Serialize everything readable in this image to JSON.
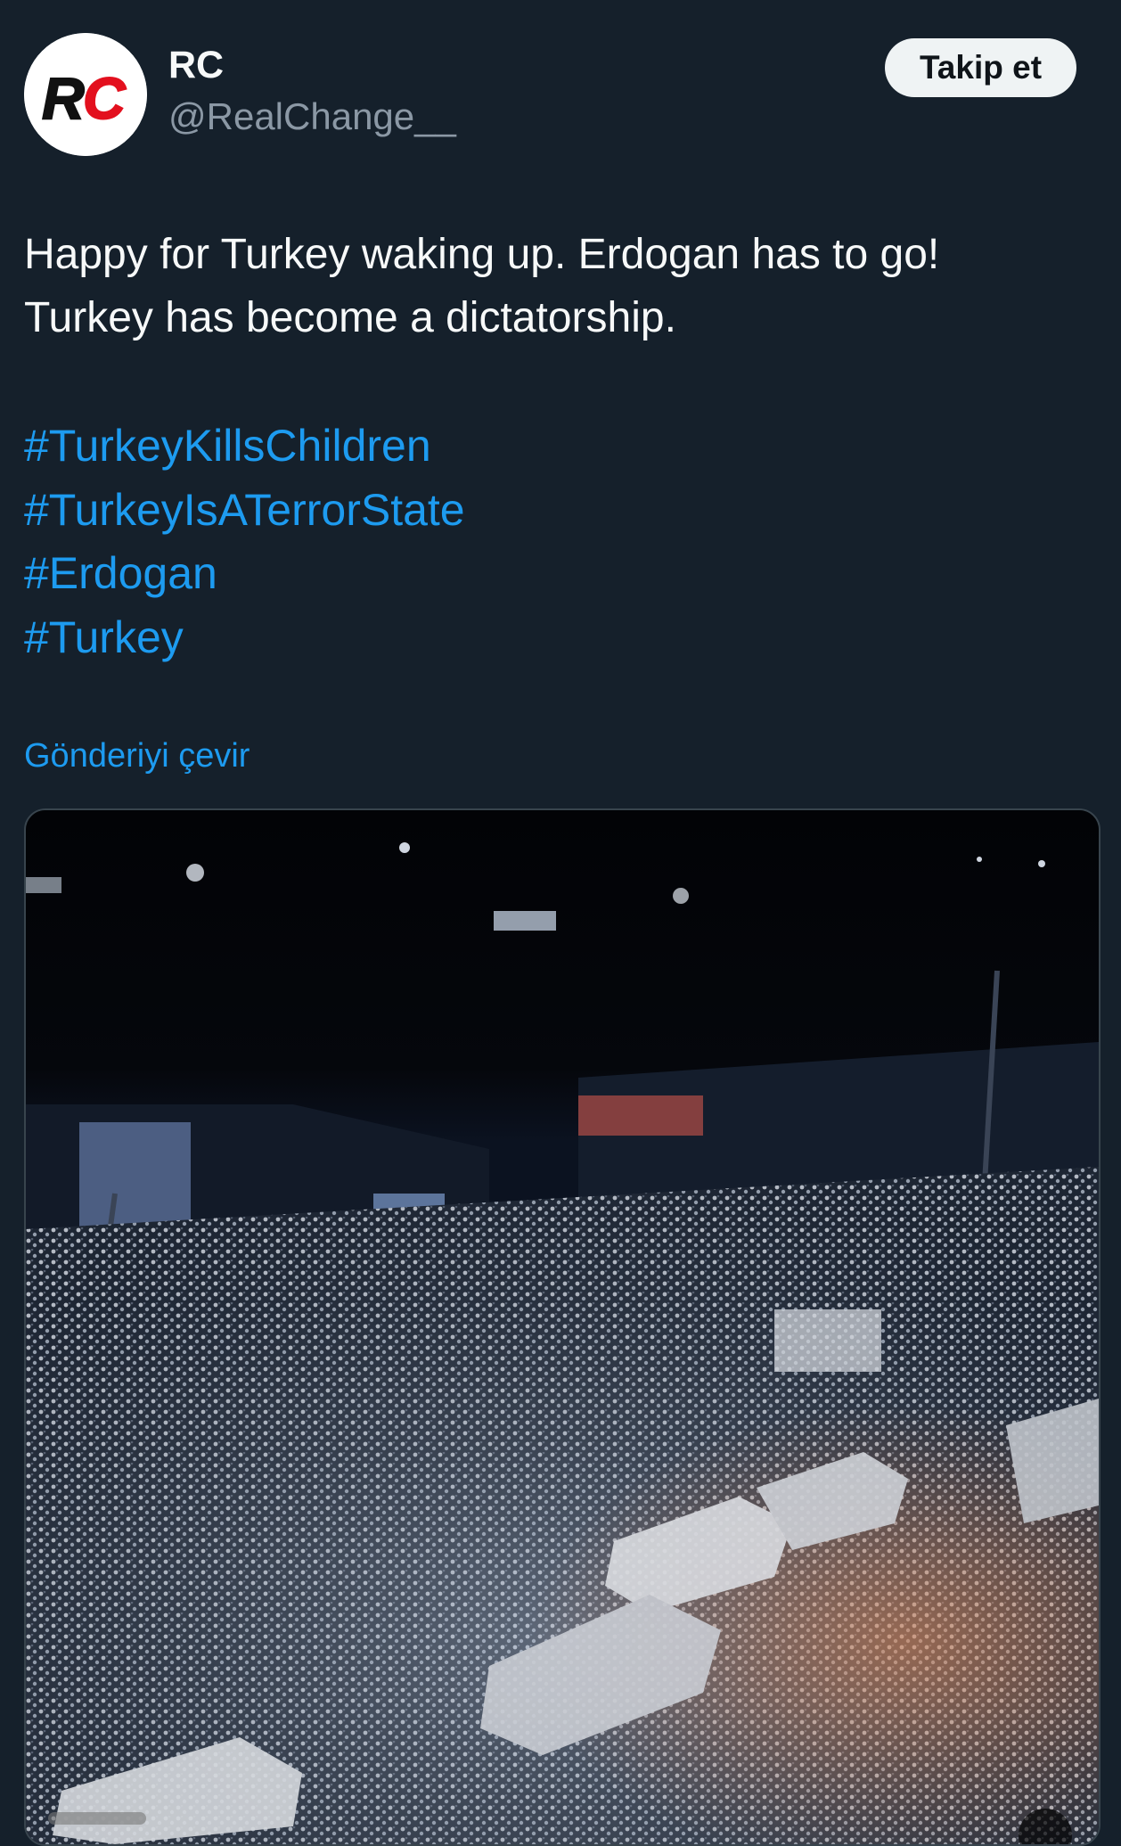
{
  "user": {
    "avatar_text": "RC",
    "display_name": "RC",
    "handle": "@RealChange__"
  },
  "follow_button_label": "Takip et",
  "tweet": {
    "text_lines": [
      "Happy for Turkey waking up. Erdogan has to go!",
      "Turkey has become a dictatorship."
    ],
    "hashtags": [
      "#TurkeyKillsChildren",
      "#TurkeyIsATerrorState",
      "#Erdogan",
      "#Turkey"
    ],
    "translate_label": "Gönderiyi çevir"
  },
  "media": {
    "type": "video",
    "description_icon": "crowd-night-photo"
  },
  "colors": {
    "background": "#15202b",
    "text": "#f7f9f9",
    "secondary_text": "#8b98a5",
    "link": "#1d9bf0",
    "button_bg": "#eff3f4",
    "avatar_red": "#e3101e"
  }
}
